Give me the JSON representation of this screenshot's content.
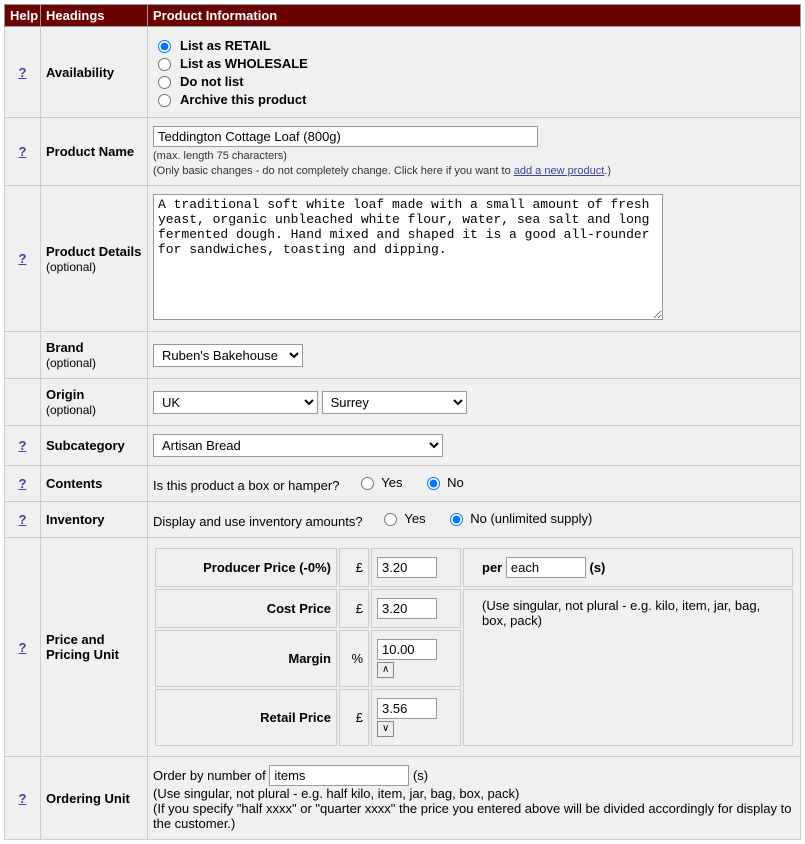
{
  "header": {
    "help": "Help",
    "headings": "Headings",
    "info": "Product Information"
  },
  "help_symbol": "?",
  "availability": {
    "label": "Availability",
    "retail": "List as RETAIL",
    "wholesale": "List as WHOLESALE",
    "dont": "Do not list",
    "archive": "Archive this product"
  },
  "product_name": {
    "label": "Product Name",
    "value": "Teddington Cottage Loaf (800g)",
    "hint1": "(max. length 75 characters)",
    "hint2a": "(Only basic changes - do not completely change. Click here if you want to ",
    "hint2_link": "add a new product",
    "hint2b": ".)"
  },
  "details": {
    "label": "Product Details",
    "optional": "(optional)",
    "value": "A traditional soft white loaf made with a small amount of fresh yeast, organic unbleached white flour, water, sea salt and long fermented dough. Hand mixed and shaped it is a good all-rounder for sandwiches, toasting and dipping."
  },
  "brand": {
    "label": "Brand",
    "optional": "(optional)",
    "value": "Ruben's Bakehouse"
  },
  "origin": {
    "label": "Origin",
    "optional": "(optional)",
    "country": "UK",
    "region": "Surrey"
  },
  "subcategory": {
    "label": "Subcategory",
    "value": "Artisan Bread"
  },
  "contents": {
    "label": "Contents",
    "question": "Is this product a box or hamper?",
    "yes": "Yes",
    "no": "No"
  },
  "inventory": {
    "label": "Inventory",
    "question": "Display and use inventory amounts?",
    "yes": "Yes",
    "no_label": "No (unlimited supply)"
  },
  "pricing": {
    "label": "Price and Pricing Unit",
    "producer_label": "Producer Price (-0%)",
    "cost_label": "Cost Price",
    "margin_label": "Margin",
    "retail_label": "Retail Price",
    "producer_value": "3.20",
    "cost_value": "3.20",
    "margin_value": "10.00",
    "retail_value": "3.56",
    "currency": "£",
    "percent": "%",
    "per": "per",
    "per_unit": "each",
    "s_suffix": "(s)",
    "per_hint": "(Use singular, not plural - e.g. kilo, item, jar, bag, box, pack)",
    "up": "∧",
    "down": "∨"
  },
  "ordering": {
    "label": "Ordering Unit",
    "prefix": "Order by number of",
    "unit": "items",
    "s_suffix": "(s)",
    "hint1": "(Use singular, not plural - e.g. half kilo, item, jar, bag, box, pack)",
    "hint2": "(If you specify \"half xxxx\" or \"quarter xxxx\" the price you entered above will be divided accordingly for display to the customer.)"
  }
}
